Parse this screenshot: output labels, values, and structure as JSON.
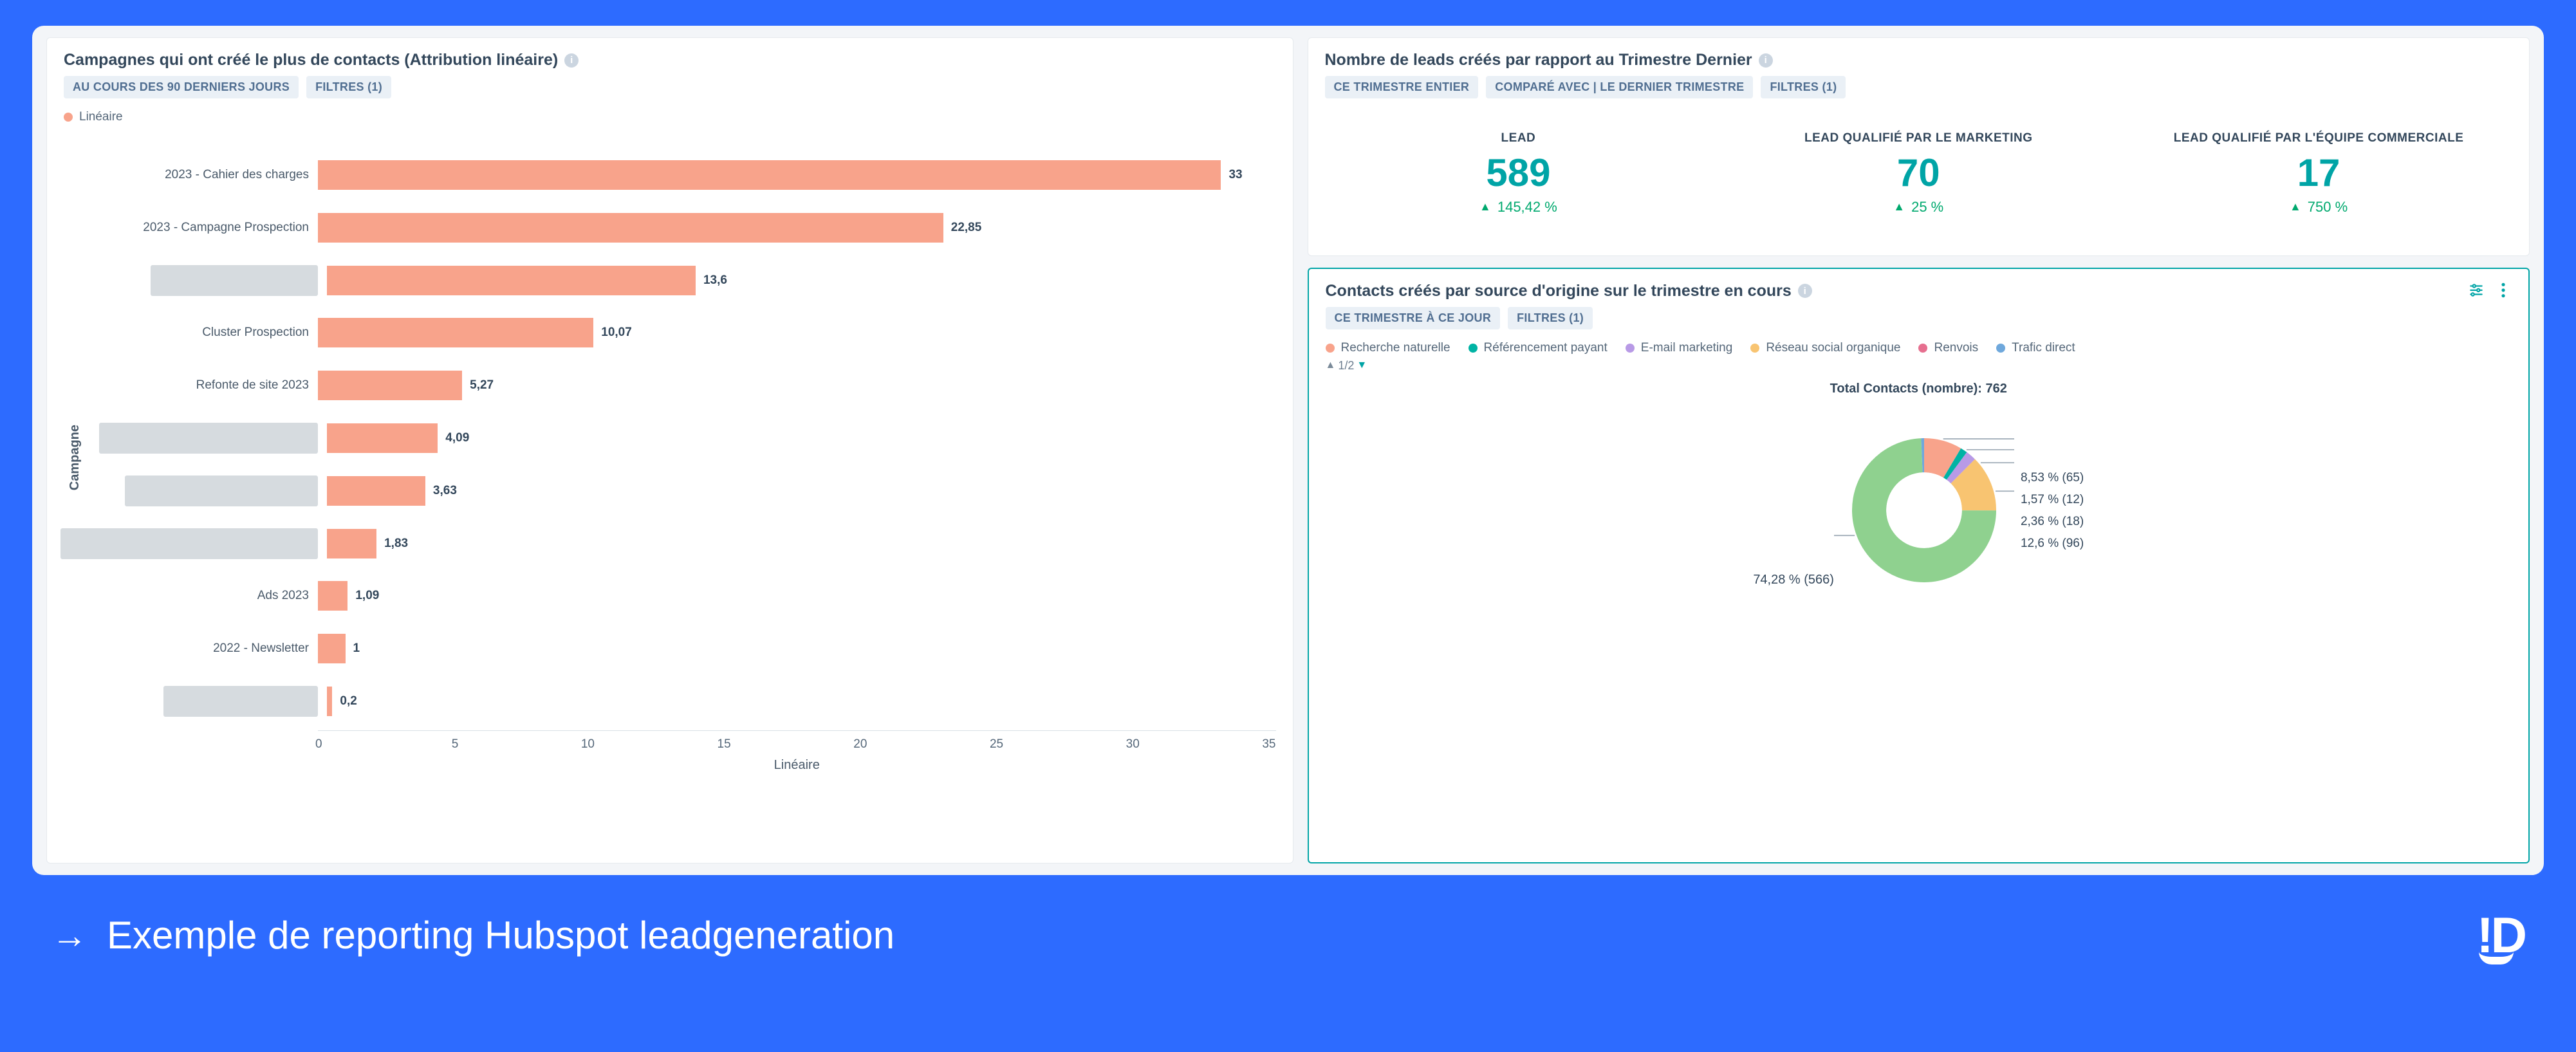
{
  "panel_campaigns": {
    "title": "Campagnes qui ont créé le plus de contacts (Attribution linéaire)",
    "chip_range": "AU COURS DES 90 DERNIERS JOURS",
    "chip_filters": "FILTRES (1)",
    "legend_series": "Linéaire",
    "ylabel": "Campagne",
    "xlabel": "Linéaire"
  },
  "chart_data": [
    {
      "type": "bar",
      "orientation": "horizontal",
      "title": "Campagnes qui ont créé le plus de contacts (Attribution linéaire)",
      "xlabel": "Linéaire",
      "ylabel": "Campagne",
      "xlim": [
        0,
        35
      ],
      "xticks": [
        0,
        5,
        10,
        15,
        20,
        25,
        30,
        35
      ],
      "series_name": "Linéaire",
      "series_color": "#f8a38b",
      "bars": [
        {
          "label": "2023 - Cahier des charges",
          "value": 33,
          "redacted": false
        },
        {
          "label": "2023 - Campagne Prospection",
          "value": 22.85,
          "redacted": false
        },
        {
          "label": "",
          "value": 13.6,
          "redacted": true,
          "redact_w": 260
        },
        {
          "label": "Cluster Prospection",
          "value": 10.07,
          "redacted": false
        },
        {
          "label": "Refonte de site 2023",
          "value": 5.27,
          "redacted": false
        },
        {
          "label": "",
          "value": 4.09,
          "redacted": true,
          "redact_w": 340
        },
        {
          "label": "",
          "value": 3.63,
          "redacted": true,
          "redact_w": 300
        },
        {
          "label": "",
          "value": 1.83,
          "redacted": true,
          "redact_w": 400
        },
        {
          "label": "Ads 2023",
          "value": 1.09,
          "redacted": false
        },
        {
          "label": "2022 - Newsletter",
          "value": 1,
          "redacted": false
        },
        {
          "label": "",
          "value": 0.2,
          "redacted": true,
          "redact_w": 240
        }
      ]
    },
    {
      "type": "pie",
      "style": "donut",
      "title": "Contacts créés par source d'origine sur le trimestre en cours",
      "total_label": "Total Contacts (nombre):",
      "total_value": 762,
      "slices": [
        {
          "name": "Recherche naturelle",
          "percent": 8.53,
          "count": 65,
          "color": "#f8a38b"
        },
        {
          "name": "Référencement payant",
          "percent": 1.57,
          "count": 12,
          "color": "#00b3a4"
        },
        {
          "name": "E-mail marketing",
          "percent": 2.36,
          "count": 18,
          "color": "#b89ae6"
        },
        {
          "name": "Réseau social organique",
          "percent": 12.6,
          "count": 96,
          "color": "#f8c471"
        },
        {
          "name": "Renvois",
          "percent": 74.28,
          "count": 566,
          "color": "#8fd18f"
        },
        {
          "name": "Trafic direct",
          "percent": 0.66,
          "count": 5,
          "color": "#6fa8dc"
        }
      ]
    }
  ],
  "panel_leads": {
    "title": "Nombre de leads créés par rapport au Trimestre Dernier",
    "chip_range": "CE TRIMESTRE ENTIER",
    "chip_compare": "COMPARÉ AVEC | LE DERNIER TRIMESTRE",
    "chip_filters": "FILTRES (1)",
    "kpis": [
      {
        "label": "LEAD",
        "value": "589",
        "delta": "145,42 %"
      },
      {
        "label": "LEAD QUALIFIÉ PAR LE MARKETING",
        "value": "70",
        "delta": "25 %"
      },
      {
        "label": "LEAD QUALIFIÉ PAR L'ÉQUIPE COMMERCIALE",
        "value": "17",
        "delta": "750 %"
      }
    ]
  },
  "panel_sources": {
    "title": "Contacts créés par source d'origine sur le trimestre en cours",
    "chip_range": "CE TRIMESTRE À CE JOUR",
    "chip_filters": "FILTRES (1)",
    "legend": [
      {
        "name": "Recherche naturelle",
        "color": "#f8a38b"
      },
      {
        "name": "Référencement payant",
        "color": "#00b3a4"
      },
      {
        "name": "E-mail marketing",
        "color": "#b89ae6"
      },
      {
        "name": "Réseau social organique",
        "color": "#f8c471"
      },
      {
        "name": "Renvois",
        "color": "#e66f8f"
      },
      {
        "name": "Trafic direct",
        "color": "#6fa8dc"
      }
    ],
    "pager": "1/2",
    "total_label": "Total Contacts (nombre):",
    "total_value": "762",
    "slice_labels": {
      "s0": "8,53 % (65)",
      "s1": "1,57 % (12)",
      "s2": "2,36 % (18)",
      "s3": "12,6 % (96)",
      "big": "74,28 % (566)"
    }
  },
  "footer": {
    "caption": "Exemple de reporting Hubspot leadgeneration"
  }
}
